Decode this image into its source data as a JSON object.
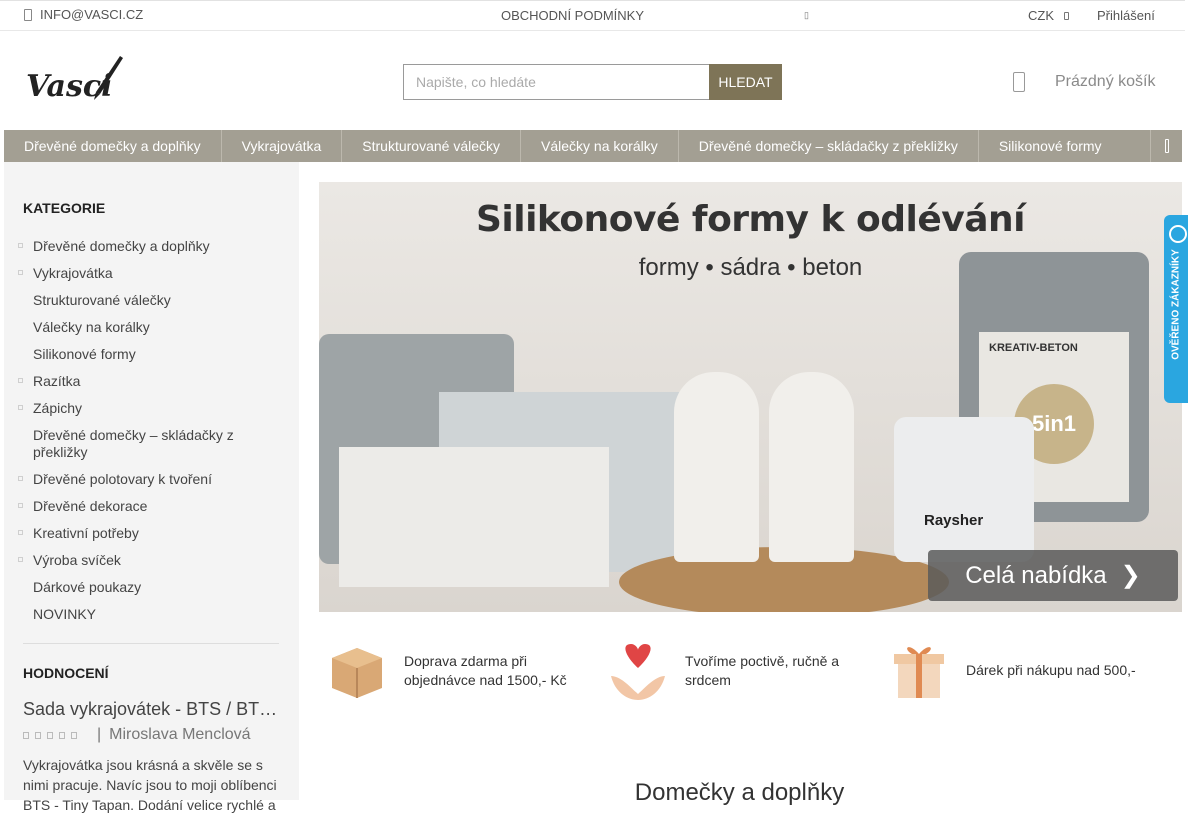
{
  "topbar": {
    "email": "INFO@VASCI.CZ",
    "terms": "OBCHODNÍ PODMÍNKY",
    "currency": "CZK",
    "login": "Přihlášení"
  },
  "header": {
    "logo_text": "Vasci",
    "search_placeholder": "Napište, co hledáte",
    "search_button": "HLEDAT",
    "cart_label": "Prázdný košík"
  },
  "nav": {
    "items": [
      "Dřevěné domečky a doplňky",
      "Vykrajovátka",
      "Strukturované válečky",
      "Válečky na korálky",
      "Dřevěné domečky – skládačky z překližky",
      "Silikonové formy"
    ]
  },
  "sidebar": {
    "categories_title": "KATEGORIE",
    "categories": [
      {
        "label": "Dřevěné domečky a doplňky",
        "bullet": true
      },
      {
        "label": "Vykrajovátka",
        "bullet": true
      },
      {
        "label": "Strukturované válečky",
        "bullet": false
      },
      {
        "label": "Válečky na korálky",
        "bullet": false
      },
      {
        "label": "Silikonové formy",
        "bullet": false
      },
      {
        "label": "Razítka",
        "bullet": true
      },
      {
        "label": "Zápichy",
        "bullet": true
      },
      {
        "label": "Dřevěné domečky – skládačky z překližky",
        "bullet": false
      },
      {
        "label": "Dřevěné polotovary k tvoření",
        "bullet": true
      },
      {
        "label": "Dřevěné dekorace",
        "bullet": true
      },
      {
        "label": "Kreativní potřeby",
        "bullet": true
      },
      {
        "label": "Výroba svíček",
        "bullet": true
      },
      {
        "label": "Dárkové poukazy",
        "bullet": false
      },
      {
        "label": "NOVINKY",
        "bullet": false
      }
    ],
    "rating_title": "HODNOCENÍ",
    "review": {
      "product": "Sada vykrajovátek - BTS / BTS - Tiny Tapan",
      "separator": "|",
      "author": "Miroslava Menclová",
      "rating": 5,
      "text": "Vykrajovátka jsou krásná a skvěle se s nimi pracuje. Navíc jsou to moji oblíbenci BTS - Tiny Tapan. Dodání velice rychlé a"
    }
  },
  "banner": {
    "headline": "Silikonové formy k odlévání",
    "subline": "formy • sádra • beton",
    "bag_brand": "KREATIV-BETON",
    "bag_badge": "5in1",
    "bucket_brand": "Raysher",
    "cta": "Celá nabídka"
  },
  "features": [
    {
      "text": "Doprava zdarma při objednávce nad 1500,- Kč",
      "icon": "box-icon"
    },
    {
      "text": "Tvoříme poctivě, ručně a srdcem",
      "icon": "heart-hands-icon"
    },
    {
      "text": "Dárek při nákupu nad 500,-",
      "icon": "gift-icon"
    }
  ],
  "section_title": "Domečky a doplňky",
  "side_badge": "OVĚŘENO ZÁKAZNÍKY",
  "colors": {
    "nav_bg": "#a39f93",
    "button_bg": "#7e7457",
    "badge_bg": "#2aa6e0",
    "sidebar_bg": "#f4f4f4"
  }
}
